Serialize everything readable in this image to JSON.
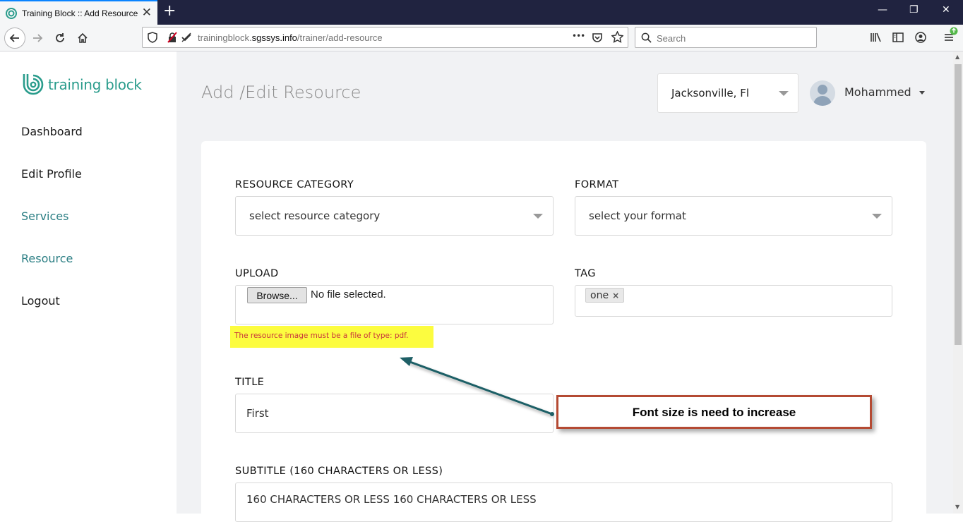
{
  "browser": {
    "tab_title": "Training Block :: Add Resource",
    "tab_close": "✕",
    "new_tab": "+",
    "url_prefix": "trainingblock.",
    "url_host": "sgssys.info",
    "url_path": "/trainer/add-resource",
    "url_more": "•••",
    "search_placeholder": "Search",
    "min_glyph": "—",
    "max_glyph": "❐",
    "close_glyph": "✕"
  },
  "sidebar": {
    "logo_text": "training block",
    "items": [
      {
        "label": "Dashboard"
      },
      {
        "label": "Edit Profile"
      },
      {
        "label": "Services"
      },
      {
        "label": "Resource"
      },
      {
        "label": "Logout"
      }
    ]
  },
  "header": {
    "page_title": "Add /Edit Resource",
    "location": "Jacksonville, Fl",
    "user_name": "Mohammed"
  },
  "form": {
    "resource_category": {
      "label": "RESOURCE CATEGORY",
      "value": "select resource category"
    },
    "format": {
      "label": "FORMAT",
      "value": "select your format"
    },
    "upload": {
      "label": "UPLOAD",
      "button": "Browse...",
      "status": "No file selected.",
      "error": "The resource image must be a file of type: pdf."
    },
    "tag": {
      "label": "TAG",
      "chips": [
        "one"
      ],
      "remove": "×"
    },
    "title": {
      "label": "TITLE",
      "value": "First"
    },
    "subtitle": {
      "label": "SUBTITLE (160 CHARACTERS OR LESS)",
      "value": "160 CHARACTERS OR LESS 160 CHARACTERS OR LESS"
    }
  },
  "annotation": {
    "text": "Font size is need to increase"
  },
  "colors": {
    "accent": "#2a9c8c",
    "nav_teal": "#2c7f84",
    "error_red": "#c8343c",
    "highlight_yellow": "#fcfc3f",
    "annotation_border": "#b44a33",
    "arrow": "#1e5f66"
  }
}
